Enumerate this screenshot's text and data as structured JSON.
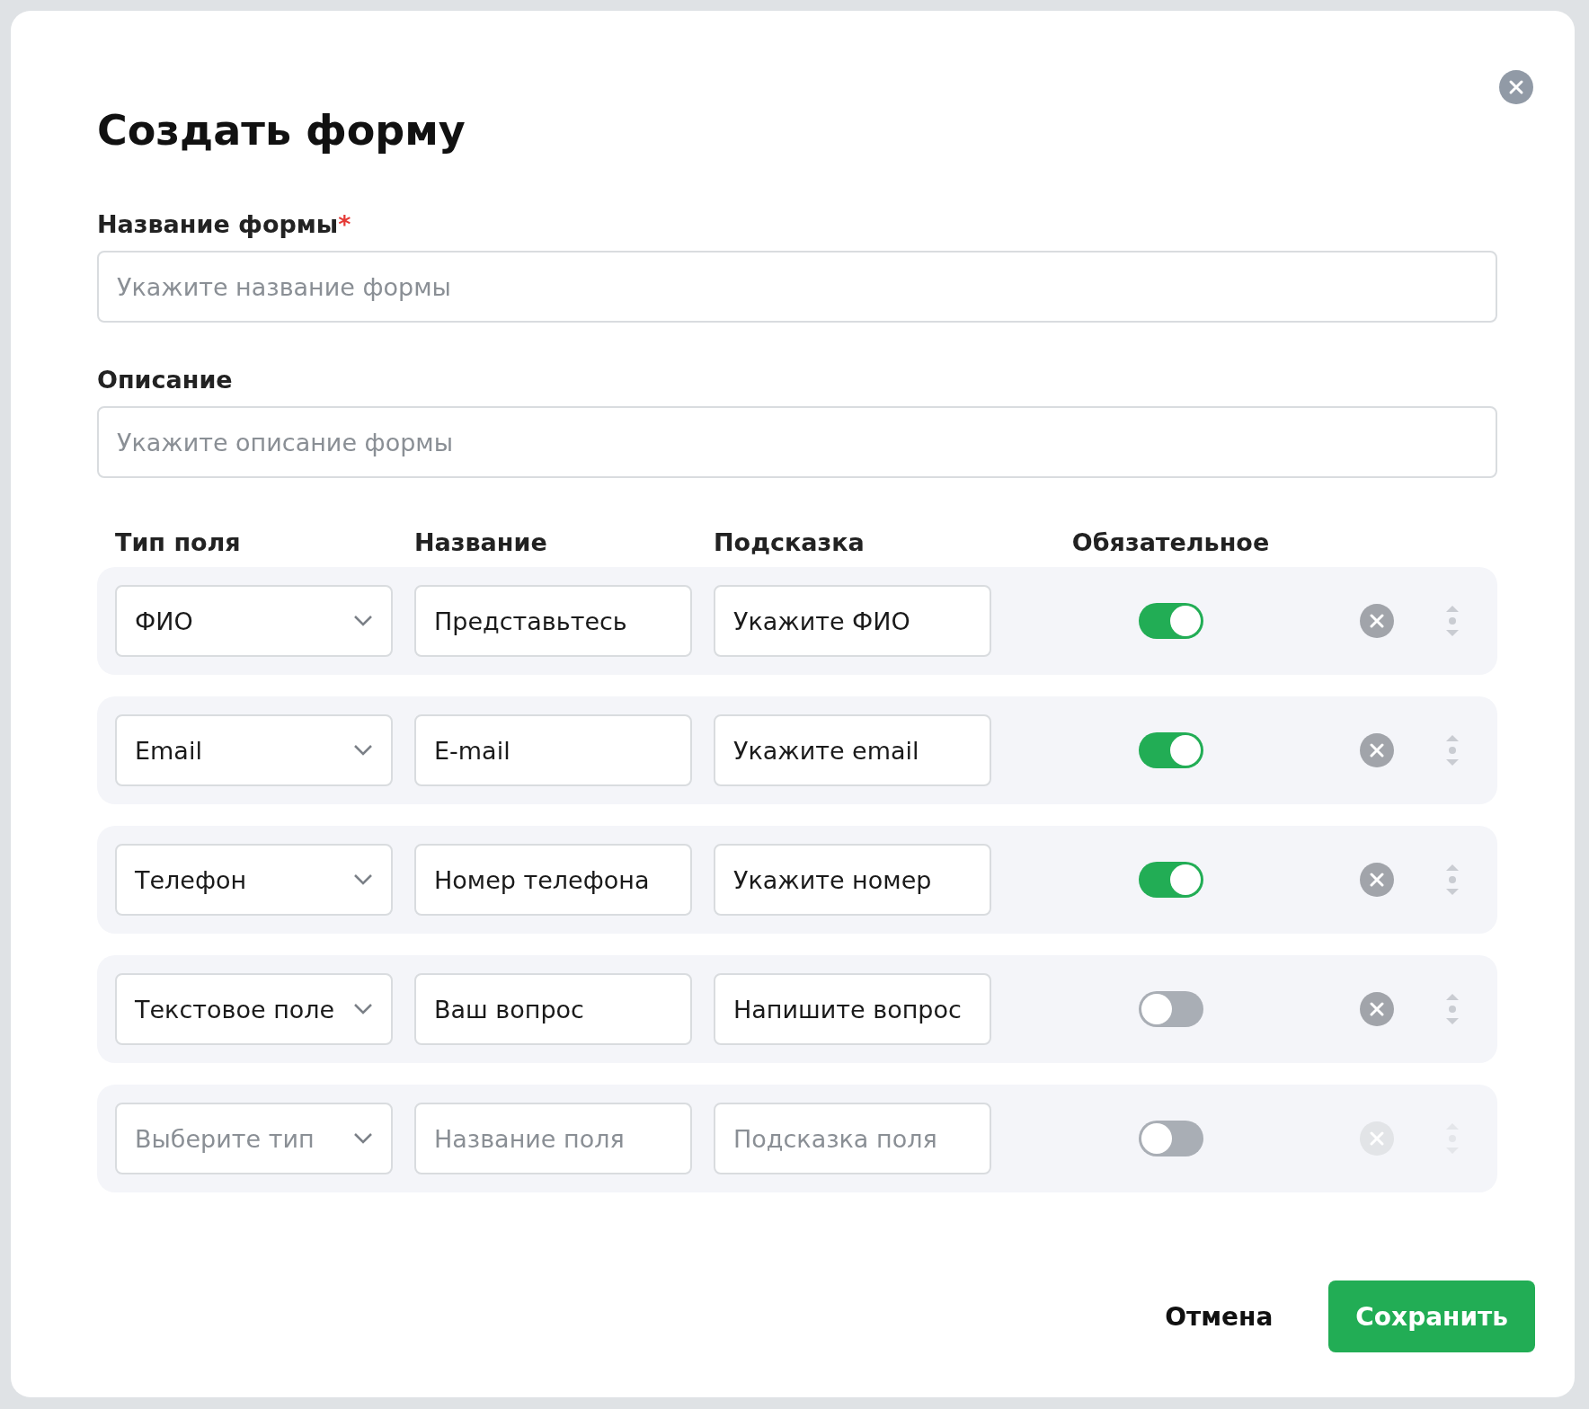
{
  "dialog": {
    "title": "Создать форму",
    "form_name": {
      "label": "Название формы",
      "required_mark": "*",
      "placeholder": "Укажите название формы"
    },
    "description": {
      "label": "Описание",
      "placeholder": "Укажите описание формы"
    },
    "columns": [
      "Тип поля",
      "Название",
      "Подсказка",
      "Обязательное"
    ],
    "rows": [
      {
        "type": {
          "value": "ФИО"
        },
        "name": {
          "value": "Представьтесь"
        },
        "hint": {
          "value": "Укажите ФИО"
        },
        "required": true,
        "disabled": false
      },
      {
        "type": {
          "value": "Email"
        },
        "name": {
          "value": "E-mail"
        },
        "hint": {
          "value": "Укажите email"
        },
        "required": true,
        "disabled": false
      },
      {
        "type": {
          "value": "Телефон"
        },
        "name": {
          "value": "Номер телефона"
        },
        "hint": {
          "value": "Укажите номер"
        },
        "required": true,
        "disabled": false
      },
      {
        "type": {
          "value": "Текстовое поле"
        },
        "name": {
          "value": "Ваш вопрос"
        },
        "hint": {
          "value": "Напишите вопрос"
        },
        "required": false,
        "disabled": false
      },
      {
        "type": {
          "placeholder": "Выберите тип"
        },
        "name": {
          "placeholder": "Название поля"
        },
        "hint": {
          "placeholder": "Подсказка поля"
        },
        "required": false,
        "disabled": true
      }
    ],
    "buttons": {
      "cancel": "Отмена",
      "save": "Сохранить"
    }
  }
}
